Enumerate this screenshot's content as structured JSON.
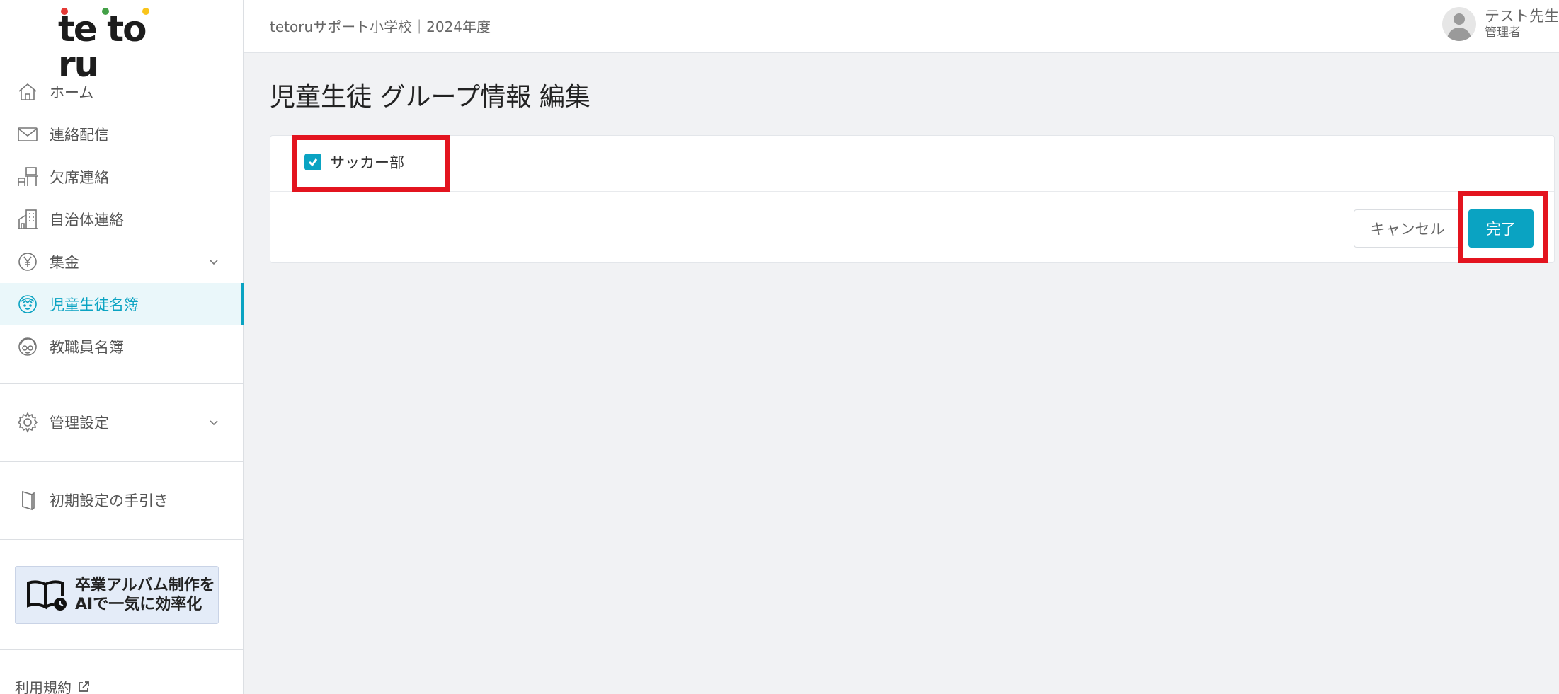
{
  "app": {
    "logo_text": "te to ru",
    "logo_colors": {
      "red": "#e53935",
      "green": "#43a047",
      "yellow": "#f9c41a"
    },
    "accent": "#0aa3c2",
    "highlight": "#e3141f"
  },
  "sidebar": {
    "items": [
      {
        "label": "ホーム",
        "icon": "home-icon"
      },
      {
        "label": "連絡配信",
        "icon": "mail-icon"
      },
      {
        "label": "欠席連絡",
        "icon": "desk-icon"
      },
      {
        "label": "自治体連絡",
        "icon": "building-icon"
      },
      {
        "label": "集金",
        "icon": "yen-icon",
        "expandable": true
      },
      {
        "label": "児童生徒名簿",
        "icon": "student-face-icon",
        "active": true
      },
      {
        "label": "教職員名簿",
        "icon": "teacher-face-icon"
      },
      {
        "label": "管理設定",
        "icon": "gear-icon",
        "expandable": true
      },
      {
        "label": "初期設定の手引き",
        "icon": "guide-book-icon"
      }
    ],
    "banner": {
      "line1": "卒業アルバム制作を",
      "line2": "AIで一気に効率化",
      "icon": "album-book-clock-icon"
    },
    "terms_label": "利用規約"
  },
  "header": {
    "school_label": "tetoruサポート小学校｜2024年度",
    "user_name": "テスト先生",
    "user_role": "管理者"
  },
  "main": {
    "title": "児童生徒 グループ情報 編集",
    "group_option": {
      "label": "サッカー部",
      "checked": true
    },
    "cancel_label": "キャンセル",
    "done_label": "完了"
  }
}
